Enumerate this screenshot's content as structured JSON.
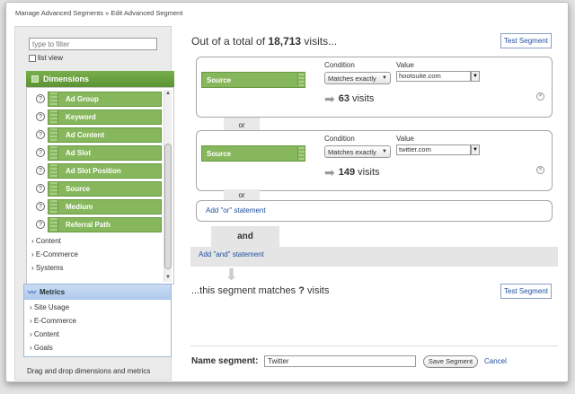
{
  "breadcrumb": {
    "parent": "Manage Advanced Segments",
    "sep": " » ",
    "current": "Edit Advanced Segment"
  },
  "filter": {
    "placeholder": "type to filter"
  },
  "list_view_label": "list view",
  "dimensions": {
    "header": "Dimensions",
    "items": [
      "Ad Group",
      "Keyword",
      "Ad Content",
      "Ad Slot",
      "Ad Slot Position",
      "Source",
      "Medium",
      "Referral Path"
    ],
    "collapsed": [
      "› Content",
      "› E-Commerce",
      "› Systems"
    ]
  },
  "metrics": {
    "header": "Metrics",
    "items": [
      "› Site Usage",
      "› E-Commerce",
      "› Content",
      "› Goals"
    ]
  },
  "drag_hint": "Drag and drop dimensions and metrics",
  "summary": {
    "prefix": "Out of a total of ",
    "total": "18,713",
    "suffix": " visits..."
  },
  "test_segment_label": "Test Segment",
  "conditions": [
    {
      "dimension": "Source",
      "condition_label": "Condition",
      "condition": "Matches exactly",
      "value_label": "Value",
      "value": "hootsuite.com",
      "visits": "63",
      "visits_suffix": "visits"
    },
    {
      "dimension": "Source",
      "condition_label": "Condition",
      "condition": "Matches exactly",
      "value_label": "Value",
      "value": "twitter.com",
      "visits": "149",
      "visits_suffix": "visits"
    }
  ],
  "or_label": "or",
  "add_or_label": "Add \"or\" statement",
  "and_label": "and",
  "add_and_label": "Add \"and\" statement",
  "matches": {
    "prefix": "...this segment matches ",
    "value": "?",
    "suffix": " visits"
  },
  "name_segment": {
    "label": "Name segment:",
    "value": "Twitter",
    "save_label": "Save Segment",
    "cancel_label": "Cancel"
  },
  "colors": {
    "dimension_green": "#87b75c",
    "header_green": "#5b9334",
    "link_blue": "#1d4e9d",
    "metrics_blue": "#aec8ec"
  }
}
